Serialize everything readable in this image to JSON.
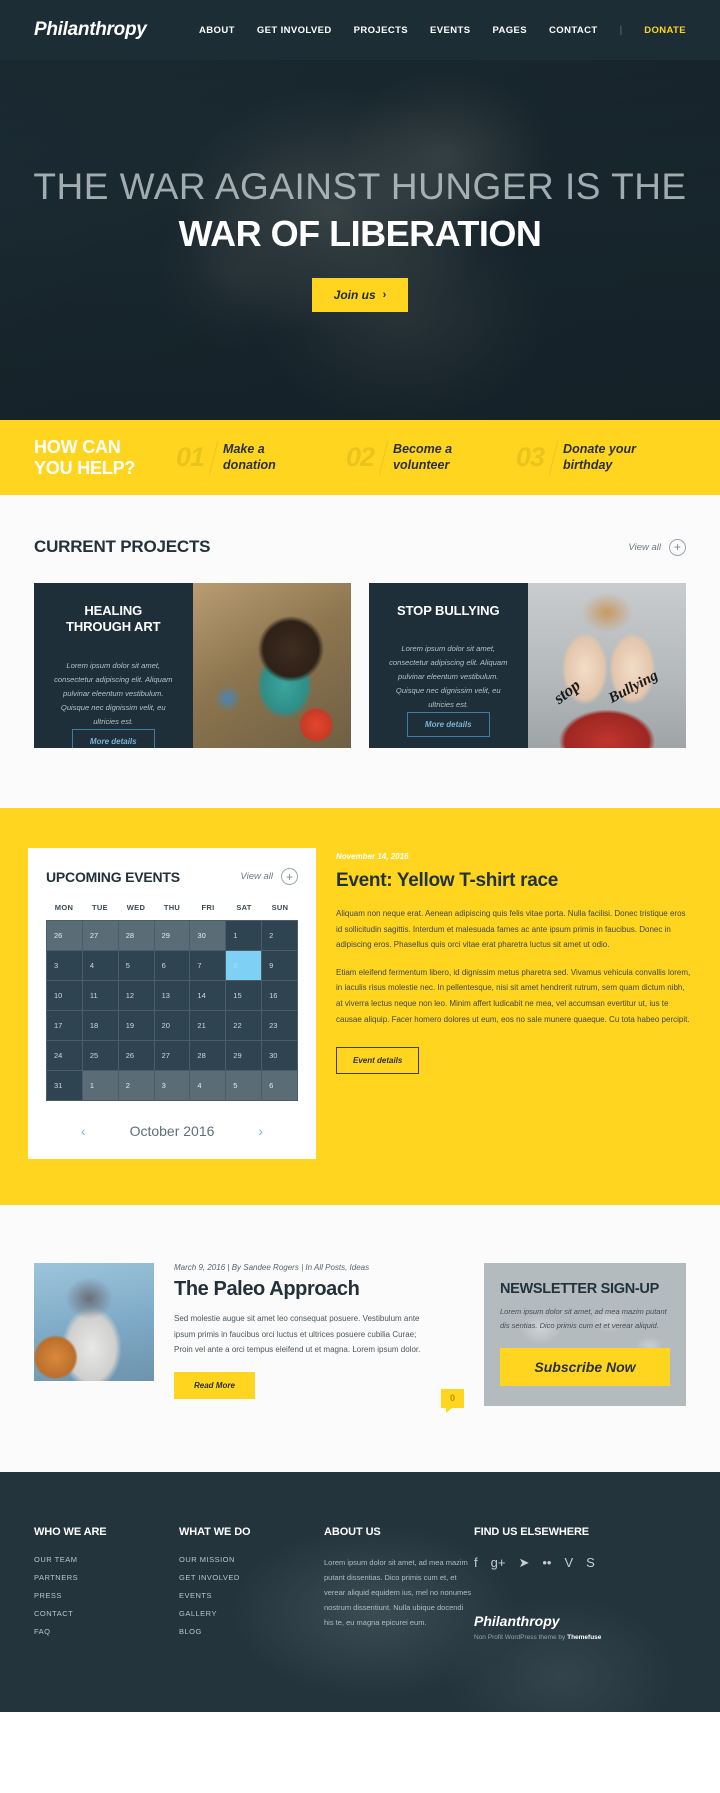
{
  "header": {
    "logo": "Philanthropy",
    "nav": [
      {
        "label": "ABOUT"
      },
      {
        "label": "GET INVOLVED"
      },
      {
        "label": "PROJECTS"
      },
      {
        "label": "EVENTS"
      },
      {
        "label": "PAGES"
      },
      {
        "label": "CONTACT"
      }
    ],
    "separator": "|",
    "donate": "DONATE"
  },
  "hero": {
    "line1": "THE WAR AGAINST HUNGER IS THE",
    "line2": "WAR OF LIBERATION",
    "button": "Join us",
    "button_chevron": "›"
  },
  "help": {
    "title_line1": "HOW CAN",
    "title_line2": "YOU HELP?",
    "steps": [
      {
        "num": "01",
        "label_line1": "Make a",
        "label_line2": "donation"
      },
      {
        "num": "02",
        "label_line1": "Become a",
        "label_line2": "volunteer"
      },
      {
        "num": "03",
        "label_line1": "Donate your",
        "label_line2": "birthday"
      }
    ]
  },
  "projects": {
    "section_title": "CURRENT PROJECTS",
    "view_all": "View all",
    "plus_icon": "+",
    "cards": [
      {
        "title_line1": "HEALING",
        "title_line2": "THROUGH ART",
        "desc": "Lorem ipsum dolor sit amet, consectetur adipiscing elit. Aliquam pulvinar eleentum vestibulum. Quisque nec dignissim velit, eu ultricies est.",
        "button": "More details"
      },
      {
        "title_line1": "STOP BULLYING",
        "title_line2": "",
        "desc": "Lorem ipsum dolor sit amet, consectetur adipiscing elit. Aliquam pulvinar eleentum vestibulum. Quisque nec dignissim velit, eu ultricies est.",
        "button": "More details",
        "overlay_word1": "stop",
        "overlay_word2": "Bullying"
      }
    ]
  },
  "events": {
    "calendar": {
      "title": "UPCOMING EVENTS",
      "view_all": "View all",
      "plus_icon": "+",
      "day_names": [
        "MON",
        "TUE",
        "WED",
        "THU",
        "FRI",
        "SAT",
        "SUN"
      ],
      "weeks": [
        [
          {
            "d": "26",
            "s": "muted"
          },
          {
            "d": "27",
            "s": "muted"
          },
          {
            "d": "28",
            "s": "muted"
          },
          {
            "d": "29",
            "s": "muted"
          },
          {
            "d": "30",
            "s": "muted"
          },
          {
            "d": "1",
            "s": ""
          },
          {
            "d": "2",
            "s": ""
          }
        ],
        [
          {
            "d": "3",
            "s": ""
          },
          {
            "d": "4",
            "s": ""
          },
          {
            "d": "5",
            "s": ""
          },
          {
            "d": "6",
            "s": ""
          },
          {
            "d": "7",
            "s": ""
          },
          {
            "d": "8",
            "s": "active"
          },
          {
            "d": "9",
            "s": ""
          }
        ],
        [
          {
            "d": "10",
            "s": ""
          },
          {
            "d": "11",
            "s": ""
          },
          {
            "d": "12",
            "s": ""
          },
          {
            "d": "13",
            "s": ""
          },
          {
            "d": "14",
            "s": ""
          },
          {
            "d": "15",
            "s": ""
          },
          {
            "d": "16",
            "s": ""
          }
        ],
        [
          {
            "d": "17",
            "s": ""
          },
          {
            "d": "18",
            "s": ""
          },
          {
            "d": "19",
            "s": ""
          },
          {
            "d": "20",
            "s": ""
          },
          {
            "d": "21",
            "s": ""
          },
          {
            "d": "22",
            "s": ""
          },
          {
            "d": "23",
            "s": ""
          }
        ],
        [
          {
            "d": "24",
            "s": ""
          },
          {
            "d": "25",
            "s": ""
          },
          {
            "d": "26",
            "s": ""
          },
          {
            "d": "27",
            "s": ""
          },
          {
            "d": "28",
            "s": ""
          },
          {
            "d": "29",
            "s": ""
          },
          {
            "d": "30",
            "s": ""
          }
        ],
        [
          {
            "d": "31",
            "s": ""
          },
          {
            "d": "1",
            "s": "muted"
          },
          {
            "d": "2",
            "s": "muted"
          },
          {
            "d": "3",
            "s": "muted"
          },
          {
            "d": "4",
            "s": "muted"
          },
          {
            "d": "5",
            "s": "muted"
          },
          {
            "d": "6",
            "s": "muted"
          }
        ]
      ],
      "prev_icon": "‹",
      "month_label": "October 2016",
      "next_icon": "›"
    },
    "detail": {
      "date": "November 14, 2016",
      "title": "Event: Yellow T-shirt race",
      "para1": "Aliquam non neque erat. Aenean adipiscing quis felis vitae porta. Nulla facilisi. Donec tristique eros id sollicitudin sagittis. Interdum et malesuada fames ac ante ipsum primis in faucibus. Donec in adipiscing eros. Phasellus quis orci vitae erat pharetra luctus sit amet ut odio.",
      "para2": "Etiam eleifend fermentum libero, id dignissim metus pharetra sed. Vivamus vehicula convallis lorem, in iaculis risus molestie nec. In pellentesque, nisi sit amet hendrerit rutrum, sem quam dictum nibh, at viverra lectus neque non leo. Minim affert ludicabit ne mea, vel accumsan evertitur ut, ius te causae aliquip. Facer homero dolores ut eum, eos no sale munere quaeque. Cu tota habeo percipit.",
      "button": "Event details"
    }
  },
  "blog": {
    "meta_date": "March 9, 2016",
    "meta_sep1": "|",
    "meta_author": "By Sandee Rogers",
    "meta_sep2": "|",
    "meta_cats": "In All Posts, Ideas",
    "title": "The Paleo Approach",
    "excerpt": "Sed molestie augue sit amet leo consequat posuere. Vestibulum ante ipsum primis in faucibus orci luctus et ultrices posuere cubilia Curae; Proin vel ante a orci tempus eleifend ut et magna. Lorem ipsum dolor.",
    "read_more": "Read More",
    "comment_count": "0"
  },
  "newsletter": {
    "title": "NEWSLETTER SIGN-UP",
    "desc": "Lorem ipsum dolor sit amet, ad mea mazim putant dis sentias. Dico primis cum et et verear aliquid.",
    "button": "Subscribe Now"
  },
  "footer": {
    "columns": [
      {
        "title": "WHO WE ARE",
        "links": [
          "OUR TEAM",
          "PARTNERS",
          "PRESS",
          "CONTACT",
          "FAQ"
        ]
      },
      {
        "title": "WHAT WE DO",
        "links": [
          "OUR MISSION",
          "GET INVOLVED",
          "EVENTS",
          "GALLERY",
          "BLOG"
        ]
      }
    ],
    "about_title": "ABOUT US",
    "about_text": "Lorem ipsum dolor sit amet, ad mea mazim putant dissentias. Dico primis cum et, et verear aliquid equidem ius, mel no nonumes nostrum dissentiunt. Nulla ubique docendi his te, eu magna epicurei eum.",
    "find_title": "FIND US ELSEWHERE",
    "social": [
      {
        "icon": "f",
        "name": "facebook-icon"
      },
      {
        "icon": "g+",
        "name": "google-plus-icon"
      },
      {
        "icon": "➤",
        "name": "twitter-icon"
      },
      {
        "icon": "••",
        "name": "flickr-icon"
      },
      {
        "icon": "V",
        "name": "vimeo-icon"
      },
      {
        "icon": "S",
        "name": "skype-icon"
      }
    ],
    "logo": "Philanthropy",
    "credit_prefix": "Non Profit WordPress theme by ",
    "credit_brand": "Themefuse"
  },
  "colors": {
    "accent_yellow": "#ffd520",
    "dark_navy": "#1d2d36",
    "footer_navy": "#23343d",
    "calendar_active": "#7fd0f5"
  }
}
